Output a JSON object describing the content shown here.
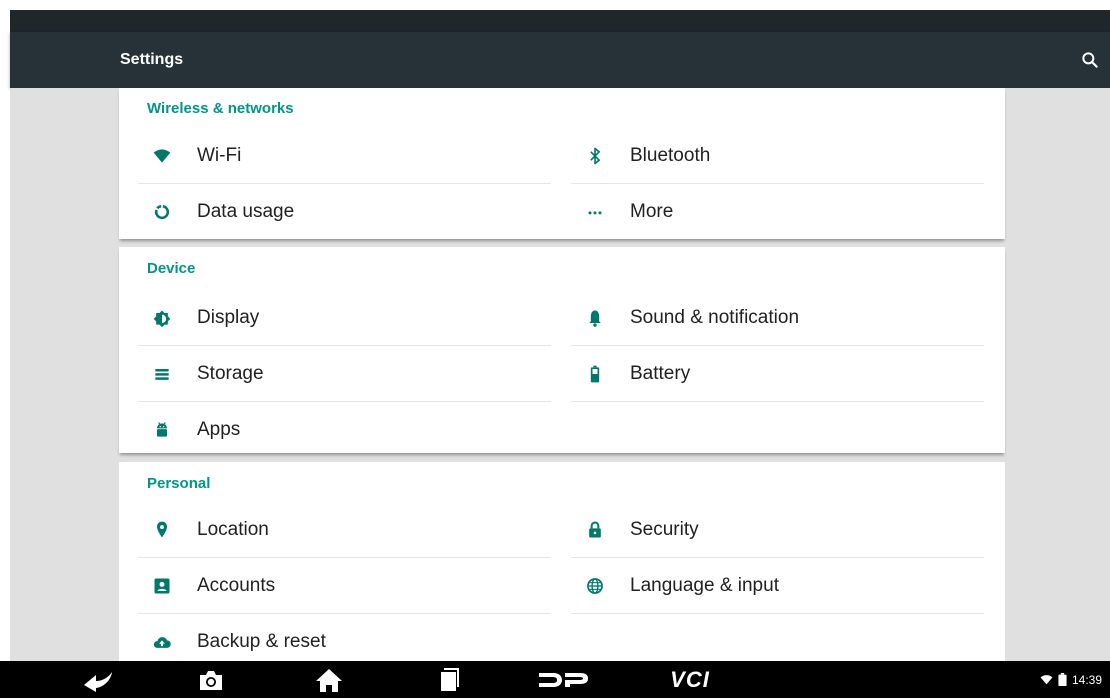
{
  "app": {
    "title": "Settings"
  },
  "sections": [
    {
      "title": "Wireless & networks",
      "items": [
        {
          "label": "Wi-Fi",
          "icon": "wifi-icon"
        },
        {
          "label": "Bluetooth",
          "icon": "bluetooth-icon"
        },
        {
          "label": "Data usage",
          "icon": "data-usage-icon"
        },
        {
          "label": "More",
          "icon": "more-icon"
        }
      ]
    },
    {
      "title": "Device",
      "items": [
        {
          "label": "Display",
          "icon": "display-icon"
        },
        {
          "label": "Sound & notification",
          "icon": "bell-icon"
        },
        {
          "label": "Storage",
          "icon": "storage-icon"
        },
        {
          "label": "Battery",
          "icon": "battery-icon"
        },
        {
          "label": "Apps",
          "icon": "android-icon"
        }
      ]
    },
    {
      "title": "Personal",
      "items": [
        {
          "label": "Location",
          "icon": "location-icon"
        },
        {
          "label": "Security",
          "icon": "lock-icon"
        },
        {
          "label": "Accounts",
          "icon": "account-icon"
        },
        {
          "label": "Language & input",
          "icon": "globe-icon"
        },
        {
          "label": "Backup & reset",
          "icon": "cloud-upload-icon"
        }
      ]
    }
  ],
  "navbar": {
    "vci_label": "VCI",
    "time": "14:39"
  },
  "colors": {
    "accent": "#009688",
    "actionbar": "#263238",
    "statusbar": "#1f272b",
    "icon": "#00796b"
  }
}
